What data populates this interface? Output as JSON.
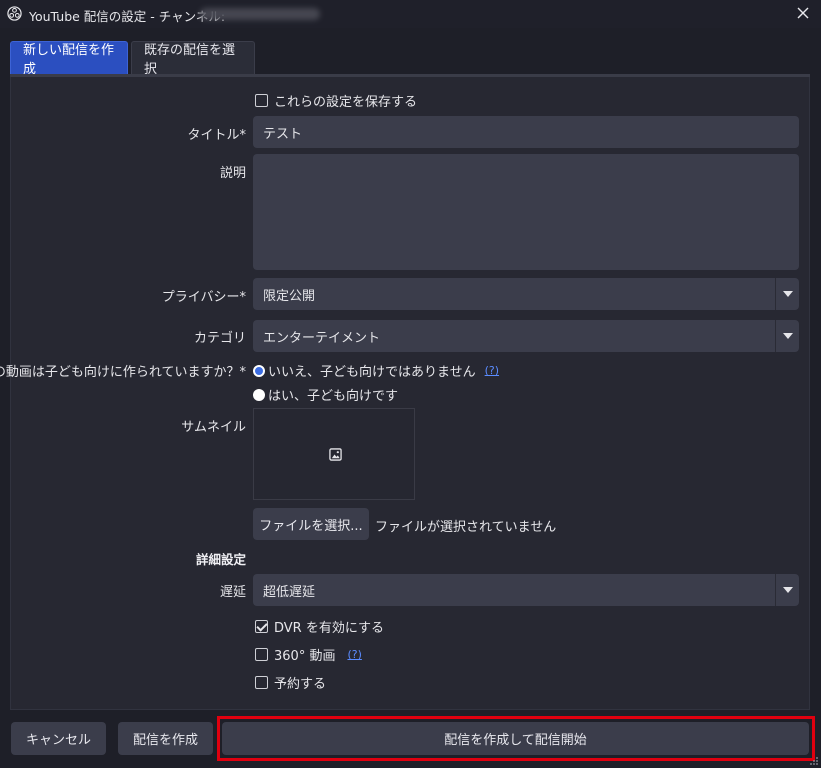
{
  "window": {
    "title": "YouTube 配信の設定 - チャンネル: ",
    "app_icon": "obs-logo-icon",
    "close_icon": "close-icon"
  },
  "tabs": [
    {
      "label": "新しい配信を作成",
      "active": true
    },
    {
      "label": "既存の配信を選択",
      "active": false
    }
  ],
  "form": {
    "remember_settings": {
      "label": "これらの設定を保存する",
      "checked": false
    },
    "title": {
      "label": "タイトル*",
      "value": "テスト"
    },
    "description": {
      "label": "説明",
      "value": ""
    },
    "privacy": {
      "label": "プライバシー*",
      "value": "限定公開"
    },
    "category": {
      "label": "カテゴリ",
      "value": "エンターテイメント"
    },
    "made_for_kids": {
      "label": "この動画は子ども向けに作られていますか？*",
      "options": [
        {
          "label": "いいえ、子ども向けではありません",
          "selected": true
        },
        {
          "label": "はい、子ども向けです",
          "selected": false
        }
      ],
      "help": "(?)"
    },
    "thumbnail": {
      "label": "サムネイル",
      "icon": "image-icon",
      "select_button": "ファイルを選択...",
      "status": "ファイルが選択されていません"
    },
    "advanced": {
      "title": "詳細設定",
      "latency": {
        "label": "遅延",
        "value": "超低遅延"
      },
      "dvr": {
        "label": "DVR を有効にする",
        "checked": true
      },
      "vr360": {
        "label": "360° 動画",
        "checked": false,
        "help": "(?)"
      },
      "schedule": {
        "label": "予約する",
        "checked": false
      }
    }
  },
  "footer": {
    "cancel": "キャンセル",
    "create": "配信を作成",
    "create_and_start": "配信を作成して配信開始"
  },
  "colors": {
    "accent_tab": "#2b4fc0",
    "highlight": "#e0000f",
    "link": "#5b8cff"
  }
}
